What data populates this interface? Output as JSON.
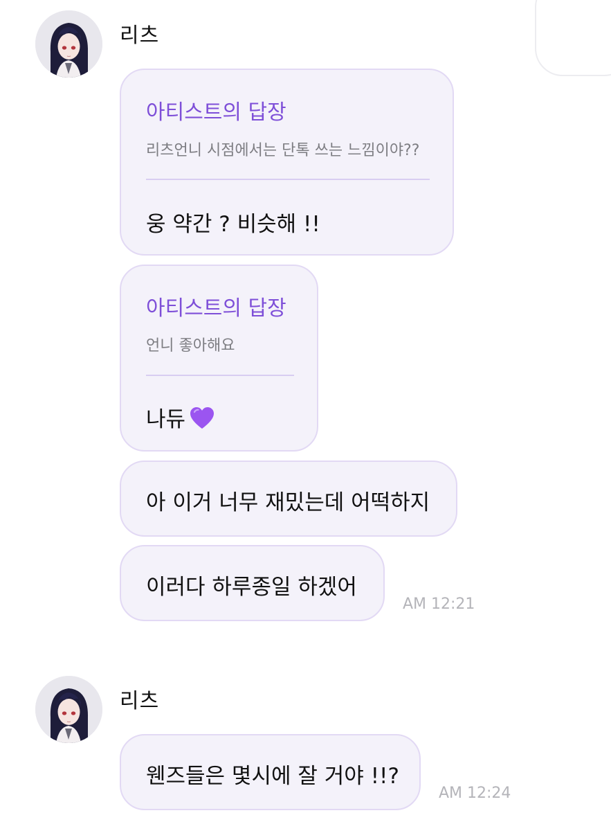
{
  "messages": [
    {
      "sender": "리츠",
      "bubbles": [
        {
          "reply_title": "아티스트의 답장",
          "reply_quote": "리츠언니 시점에서는 단톡 쓰는 느낌이야??",
          "text": "웅 약간 ? 비슷해 !!"
        },
        {
          "reply_title": "아티스트의 답장",
          "reply_quote": "언니 좋아해요",
          "text": "나듀",
          "emoji": "purple-heart-icon"
        },
        {
          "text": "아 이거 너무 재밌는데 어떡하지"
        },
        {
          "text": "이러다 하루종일 하겠어"
        }
      ],
      "time": "AM 12:21"
    },
    {
      "sender": "리츠",
      "bubbles": [
        {
          "text": "웬즈들은 몇시에 잘 거야 !!?"
        }
      ],
      "time": "AM 12:24"
    }
  ],
  "colors": {
    "bubble_bg": "#f4f2fa",
    "bubble_border": "#e2d9f4",
    "reply_title": "#7e4fd8",
    "heart": "#9b55f0"
  }
}
